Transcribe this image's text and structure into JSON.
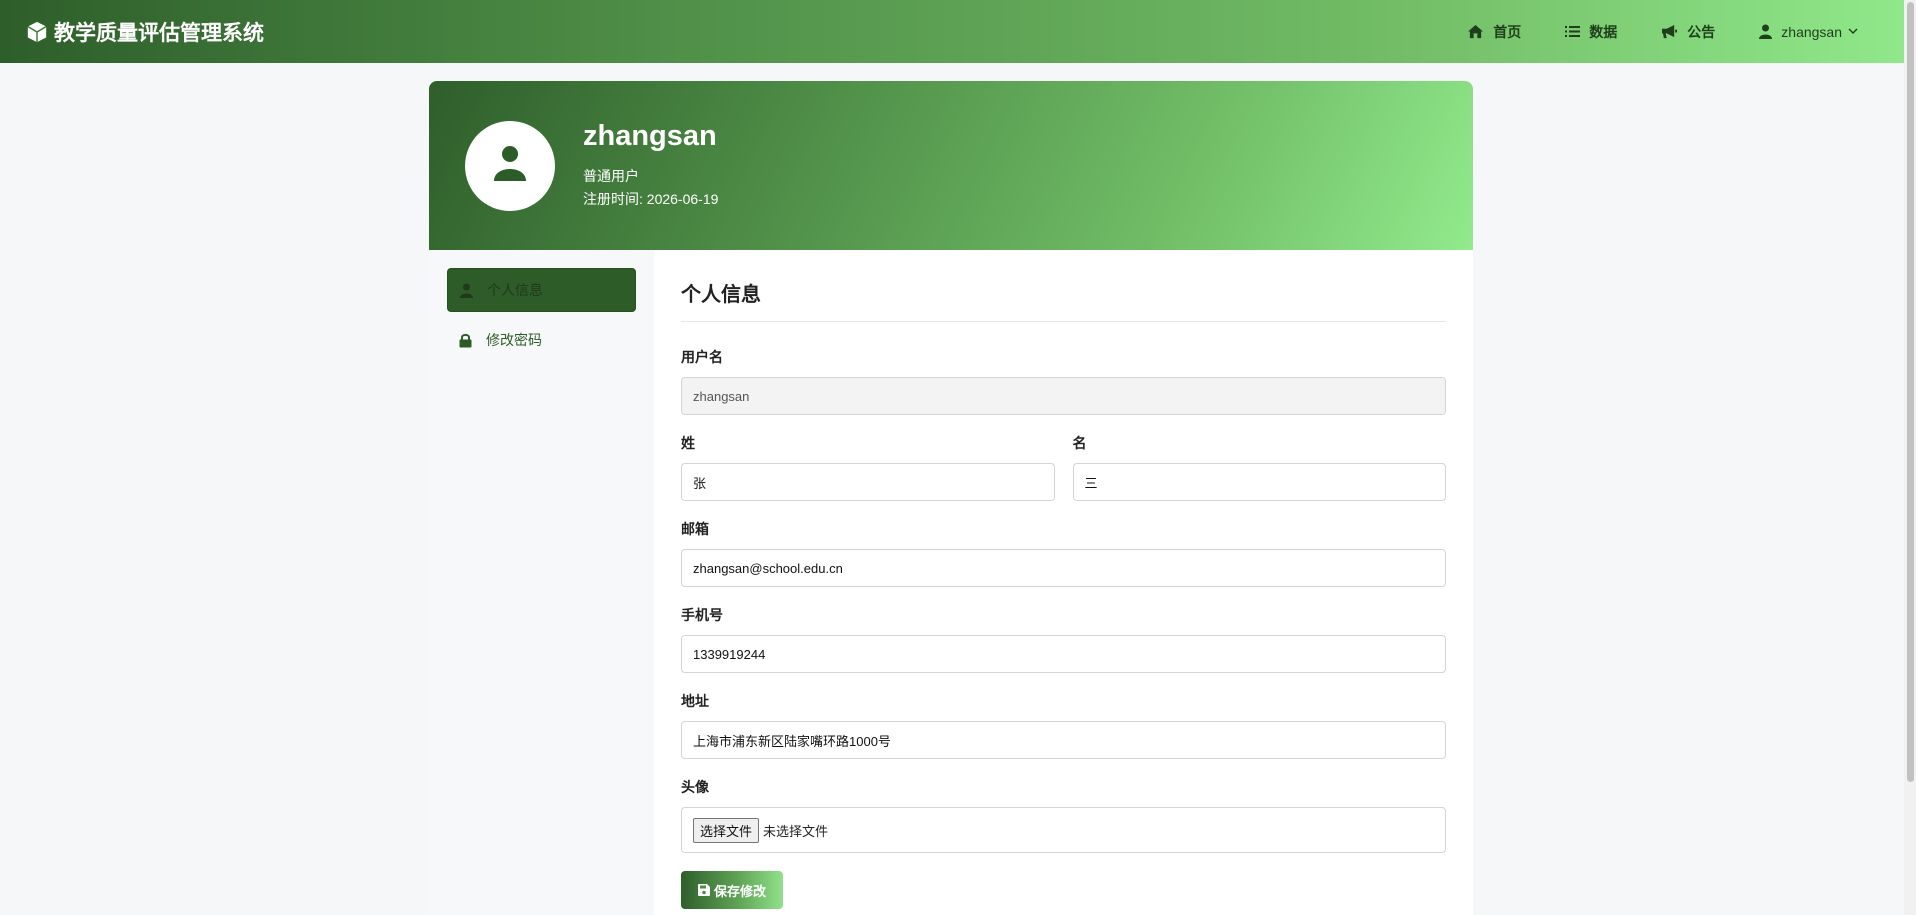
{
  "navbar": {
    "brand": "教学质量评估管理系统",
    "links": [
      {
        "label": "首页",
        "icon": "home-icon"
      },
      {
        "label": "数据",
        "icon": "list-icon"
      },
      {
        "label": "公告",
        "icon": "megaphone-icon"
      }
    ],
    "user": "zhangsan"
  },
  "profile": {
    "name": "zhangsan",
    "role": "普通用户",
    "registered": "注册时间: 2026-06-19"
  },
  "sidebar": {
    "items": [
      {
        "label": "个人信息",
        "icon": "user-icon",
        "active": true
      },
      {
        "label": "修改密码",
        "icon": "lock-icon",
        "active": false
      }
    ]
  },
  "form": {
    "title": "个人信息",
    "username_label": "用户名",
    "username_value": "zhangsan",
    "last_name_label": "姓",
    "last_name_value": "张",
    "first_name_label": "名",
    "first_name_value": "三",
    "email_label": "邮箱",
    "email_value": "zhangsan@school.edu.cn",
    "phone_label": "手机号",
    "phone_value": "1339919244",
    "address_label": "地址",
    "address_value": "上海市浦东新区陆家嘴环路1000号",
    "avatar_label": "头像",
    "file_button": "选择文件",
    "file_status": "未选择文件",
    "save_label": "保存修改"
  },
  "colors": {
    "primary_dark": "#2d5c28",
    "primary_light": "#90e88a"
  }
}
